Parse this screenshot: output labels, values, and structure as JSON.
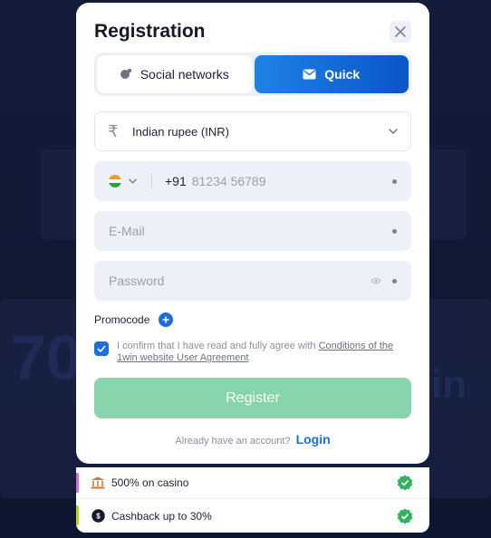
{
  "modal": {
    "title": "Registration",
    "tabs": [
      {
        "label": "Social networks",
        "icon": "chat-icon",
        "active": false
      },
      {
        "label": "Quick",
        "icon": "mail-icon",
        "active": true
      }
    ],
    "currency": {
      "symbol": "₹",
      "value": "Indian rupee (INR)"
    },
    "phone": {
      "code": "+91",
      "placeholder": "81234 56789"
    },
    "email": {
      "placeholder": "E-Mail"
    },
    "password": {
      "placeholder": "Password"
    },
    "promocode_label": "Promocode",
    "agreement": {
      "text": "I confirm that I have read and fully agree with ",
      "link": "Conditions of the 1win website User Agreement",
      "checked": true
    },
    "register_label": "Register",
    "login_prompt": "Already have an account?",
    "login_label": "Login"
  },
  "bonuses": [
    {
      "text": "500% on casino",
      "icon": "casino-icon",
      "accent": "#d46bd8"
    },
    {
      "text": "Cashback up to 30%",
      "icon": "cashback-icon",
      "accent": "#b7d32a"
    }
  ],
  "colors": {
    "primary": "#1a6fe0",
    "register_button": "#88d5ab",
    "check_green": "#2fb35e"
  }
}
